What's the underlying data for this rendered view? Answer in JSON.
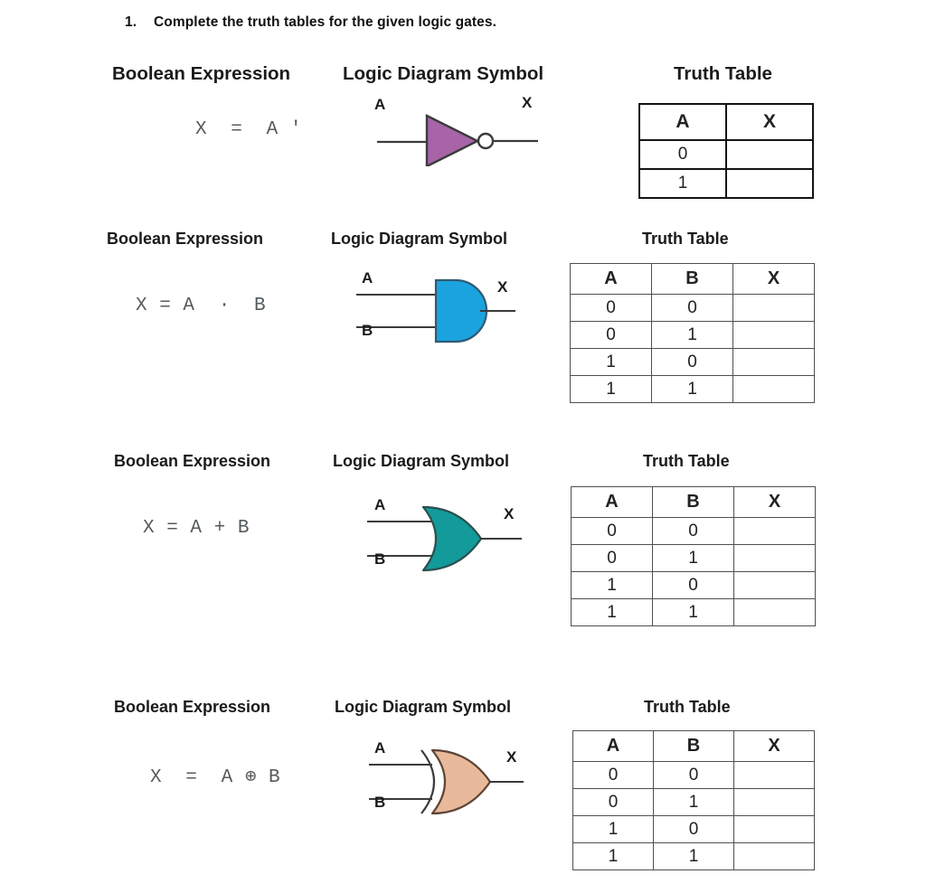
{
  "question": {
    "number": "1.",
    "text": "Complete the truth tables for the given logic gates."
  },
  "column_headers": {
    "expression": "Boolean Expression",
    "symbol": "Logic Diagram Symbol",
    "truth_table": "Truth Table"
  },
  "colors": {
    "not_gate": "#a765a7",
    "and_gate": "#1ba3e0",
    "or_gate": "#139a9a",
    "xor_gate": "#e8b99a",
    "gate_outline": "#3b3b3b",
    "wire": "#3b3b3b",
    "table_border_dark": "#141414",
    "table_border": "#4f4f4f",
    "expression_text": "#555b5e"
  },
  "sections": [
    {
      "id": "not",
      "gate_name": "NOT",
      "headers": {
        "expression": "Boolean Expression",
        "symbol": "Logic Diagram Symbol",
        "truth_table": "Truth Table"
      },
      "expression": "X  =  A '",
      "pins": {
        "in_a": "A",
        "in_b": "",
        "out": "X"
      },
      "table": {
        "columns": [
          "A",
          "X"
        ],
        "rows": [
          [
            "0",
            ""
          ],
          [
            "1",
            ""
          ]
        ]
      }
    },
    {
      "id": "and",
      "gate_name": "AND",
      "headers": {
        "expression": "Boolean Expression",
        "symbol": "Logic Diagram Symbol",
        "truth_table": "Truth Table"
      },
      "expression": "X = A  ·  B",
      "pins": {
        "in_a": "A",
        "in_b": "B",
        "out": "X"
      },
      "table": {
        "columns": [
          "A",
          "B",
          "X"
        ],
        "rows": [
          [
            "0",
            "0",
            ""
          ],
          [
            "0",
            "1",
            ""
          ],
          [
            "1",
            "0",
            ""
          ],
          [
            "1",
            "1",
            ""
          ]
        ]
      }
    },
    {
      "id": "or",
      "gate_name": "OR",
      "headers": {
        "expression": "Boolean Expression",
        "symbol": "Logic Diagram Symbol",
        "truth_table": "Truth Table"
      },
      "expression": "X = A + B",
      "pins": {
        "in_a": "A",
        "in_b": "B",
        "out": "X"
      },
      "table": {
        "columns": [
          "A",
          "B",
          "X"
        ],
        "rows": [
          [
            "0",
            "0",
            ""
          ],
          [
            "0",
            "1",
            ""
          ],
          [
            "1",
            "0",
            ""
          ],
          [
            "1",
            "1",
            ""
          ]
        ]
      }
    },
    {
      "id": "xor",
      "gate_name": "XOR",
      "headers": {
        "expression": "Boolean Expression",
        "symbol": "Logic Diagram Symbol",
        "truth_table": "Truth Table"
      },
      "expression": "X  =  A ⊕ B",
      "pins": {
        "in_a": "A",
        "in_b": "B",
        "out": "X"
      },
      "table": {
        "columns": [
          "A",
          "B",
          "X"
        ],
        "rows": [
          [
            "0",
            "0",
            ""
          ],
          [
            "0",
            "1",
            ""
          ],
          [
            "1",
            "0",
            ""
          ],
          [
            "1",
            "1",
            ""
          ]
        ]
      }
    }
  ]
}
